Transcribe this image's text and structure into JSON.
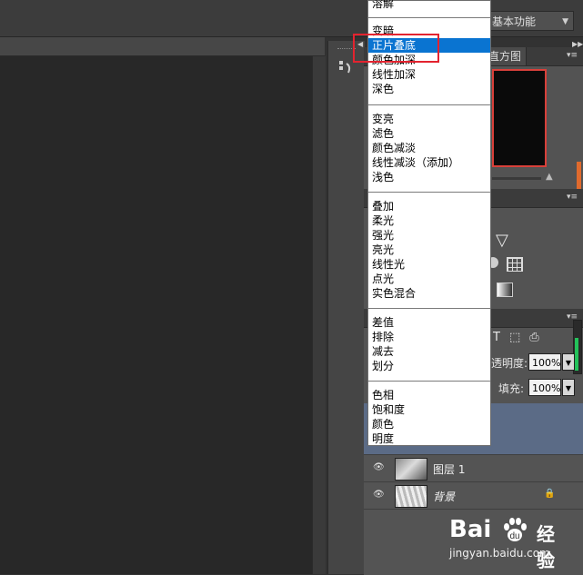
{
  "workspace": {
    "label": "基本功能"
  },
  "panels": {
    "histogram_tab": "直方图",
    "opacity_label": "透明度:",
    "opacity_value": "100%",
    "fill_label": "填充:",
    "fill_value": "100%",
    "layers": [
      {
        "name": "图层 1"
      },
      {
        "name": "背景"
      }
    ]
  },
  "blend_menu": {
    "groups": [
      [
        "溶解"
      ],
      [
        "变暗",
        "正片叠底",
        "颜色加深",
        "线性加深",
        "深色"
      ],
      [
        "变亮",
        "滤色",
        "颜色减淡",
        "线性减淡（添加）",
        "浅色"
      ],
      [
        "叠加",
        "柔光",
        "强光",
        "亮光",
        "线性光",
        "点光",
        "实色混合"
      ],
      [
        "差值",
        "排除",
        "减去",
        "划分"
      ],
      [
        "色相",
        "饱和度",
        "颜色",
        "明度"
      ]
    ],
    "selected": "正片叠底"
  },
  "watermark": {
    "brand": "Bai",
    "jingyan": "经验",
    "url": "jingyan.baidu.com"
  },
  "colors": {
    "selection": "#0a74d1",
    "highlight_box": "#e3232f",
    "layer_selected": "#5b6b86"
  }
}
